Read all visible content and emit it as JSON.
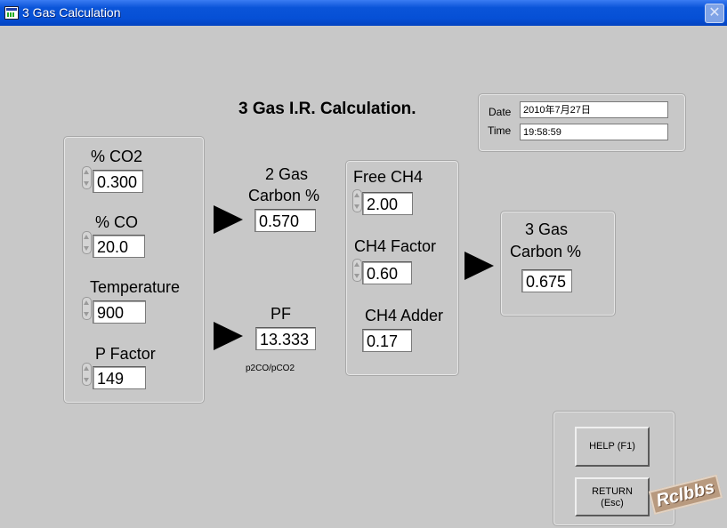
{
  "window": {
    "title": "3 Gas Calculation"
  },
  "heading": "3 Gas I.R. Calculation.",
  "datetime": {
    "date_label": "Date",
    "date_value": "2010年7月27日",
    "time_label": "Time",
    "time_value": "19:58:59"
  },
  "inputs": [
    {
      "label": "% CO2",
      "value": "0.300"
    },
    {
      "label": "% CO",
      "value": "20.0"
    },
    {
      "label": "Temperature",
      "value": "900"
    },
    {
      "label": "P Factor",
      "value": "149"
    }
  ],
  "two_gas": {
    "label_line1": "2 Gas",
    "label_line2": "Carbon %",
    "value": "0.570"
  },
  "pf": {
    "label": "PF",
    "value": "13.333",
    "note": "p2CO/pCO2"
  },
  "ch4": {
    "free_label": "Free CH4",
    "free_value": "2.00",
    "factor_label": "CH4 Factor",
    "factor_value": "0.60",
    "adder_label": "CH4 Adder",
    "adder_value": "0.17"
  },
  "three_gas": {
    "label_line1": "3 Gas",
    "label_line2": "Carbon %",
    "value": "0.675"
  },
  "buttons": {
    "help": "HELP (F1)",
    "return_line1": "RETURN",
    "return_line2": "(Esc)"
  },
  "watermark": "Rclbbs"
}
